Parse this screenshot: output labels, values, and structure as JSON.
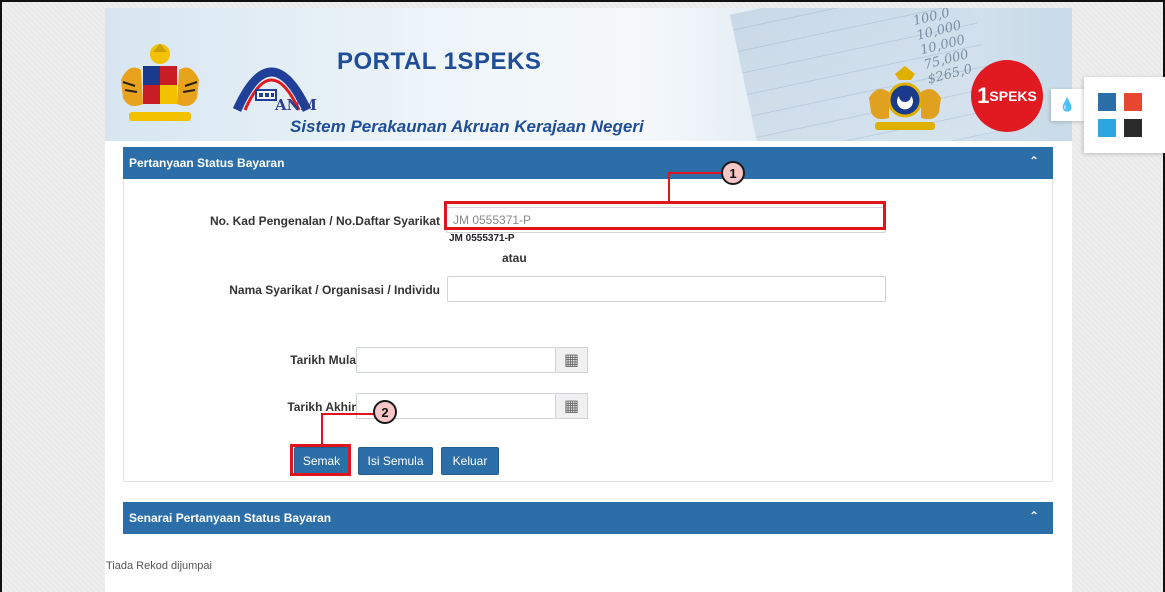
{
  "header": {
    "title": "PORTAL 1SPEKS",
    "subtitle": "Sistem Perakaunan Akruan Kerajaan Negeri",
    "anm": "ANM",
    "badge_prefix": "1",
    "badge_text": "SPEKS",
    "numbers": [
      "100,0",
      "10,000",
      "10,000",
      "75,000",
      "$265,0"
    ]
  },
  "form_panel": {
    "title": "Pertanyaan Status Bayaran",
    "id_label": "No. Kad Pengenalan / No.Daftar Syarikat",
    "id_value": "JM 0555371-P",
    "id_suggestion": "JM 0555371-P",
    "or_text": "atau",
    "name_label": "Nama Syarikat / Organisasi / Individu",
    "name_value": "",
    "start_label": "Tarikh Mula",
    "end_label": "Tarikh Akhir",
    "buttons": {
      "check": "Semak",
      "reset": "Isi Semula",
      "exit": "Keluar"
    }
  },
  "list_panel": {
    "title": "Senarai Pertanyaan Status Bayaran",
    "empty_text": "Tiada Rekod dijumpai"
  },
  "annotations": {
    "marker1": "1",
    "marker2": "2"
  },
  "theme_colors": [
    "#2c6ea8",
    "#e8462e",
    "#2da6e0",
    "#2b2b2b"
  ],
  "icons": {
    "collapse": "chevron-up-icon",
    "calendar": "calendar-icon",
    "drop": "ink-drop-icon"
  }
}
